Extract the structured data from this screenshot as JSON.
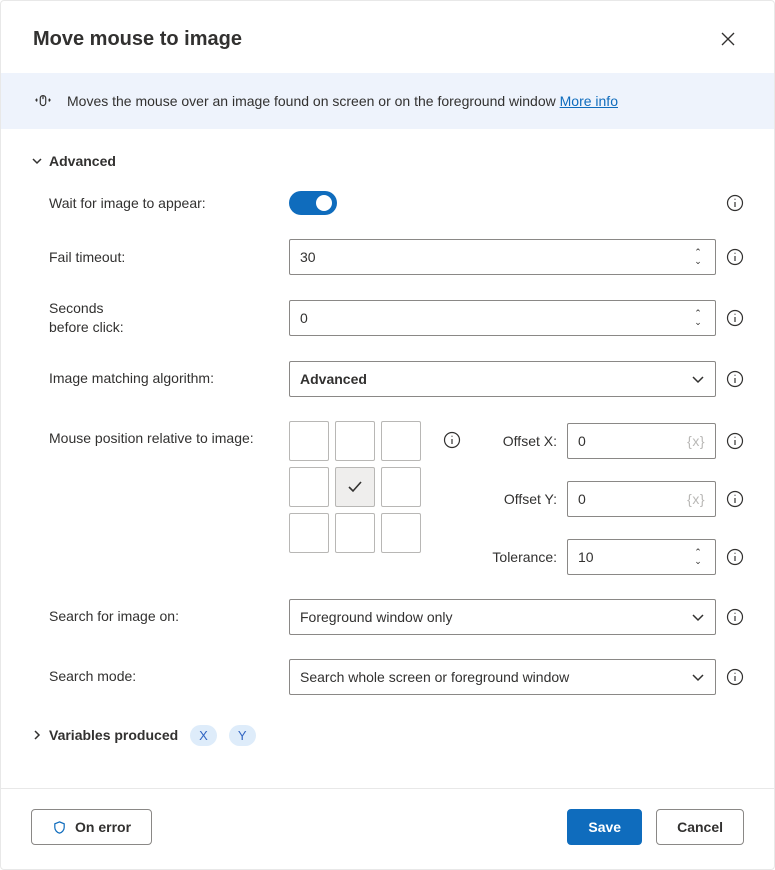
{
  "header": {
    "title": "Move mouse to image"
  },
  "banner": {
    "text": "Moves the mouse over an image found on screen or on the foreground window ",
    "more_info": "More info"
  },
  "sections": {
    "advanced": "Advanced",
    "variables": "Variables produced",
    "var_x": "X",
    "var_y": "Y"
  },
  "fields": {
    "wait_label": "Wait for image to appear:",
    "fail_timeout_label": "Fail timeout:",
    "fail_timeout_value": "30",
    "seconds_before_click_label": "Seconds\nbefore click:",
    "seconds_before_click_value": "0",
    "image_matching_label": "Image matching algorithm:",
    "image_matching_value": "Advanced",
    "mouse_pos_label": "Mouse position relative to image:",
    "offset_x_label": "Offset X:",
    "offset_x_value": "0",
    "offset_y_label": "Offset Y:",
    "offset_y_value": "0",
    "tolerance_label": "Tolerance:",
    "tolerance_value": "10",
    "search_on_label": "Search for image on:",
    "search_on_value": "Foreground window only",
    "search_mode_label": "Search mode:",
    "search_mode_value": "Search whole screen or foreground window",
    "variable_placeholder": "{x}"
  },
  "footer": {
    "on_error": "On error",
    "save": "Save",
    "cancel": "Cancel"
  }
}
